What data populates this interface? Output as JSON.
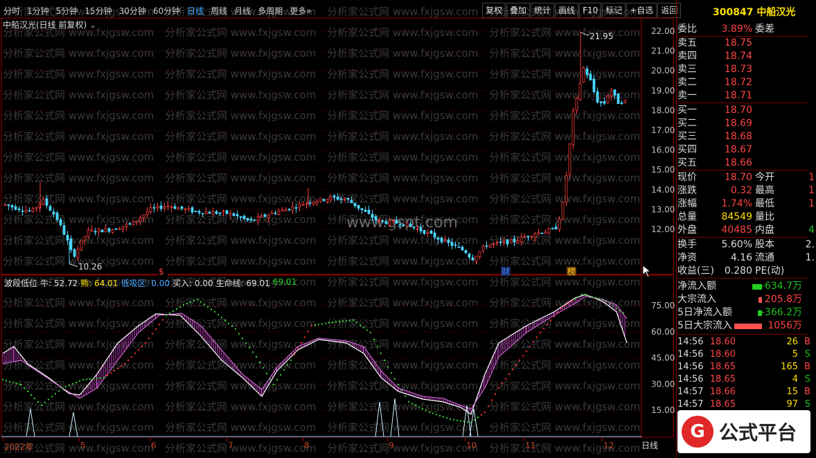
{
  "toolbar": {
    "periods": [
      "分时",
      "1分钟",
      "5分钟",
      "15分钟",
      "30分钟",
      "60分钟",
      "日线",
      "周线",
      "月线",
      "多周期",
      "更多»"
    ],
    "active": "日线",
    "buttons": [
      "复权",
      "叠加",
      "统计",
      "画线",
      "F10",
      "标记",
      "+自选",
      "返回"
    ]
  },
  "chart": {
    "title": "中船汉光(日线 前复权)",
    "price_ticks": [
      "22.00",
      "21.00",
      "20.00",
      "19.00",
      "18.00",
      "17.00",
      "16.00",
      "15.00",
      "14.00",
      "13.00",
      "12.00"
    ],
    "high_label": "21.95",
    "low_label": "10.26",
    "markers": [
      "$",
      "财",
      "榜"
    ],
    "watermark_center": "www.gspt.com",
    "watermark": "分析家公式网 www.fxjgsw.com"
  },
  "indicator": {
    "name": "波段低位",
    "items": [
      {
        "k": "牛:",
        "v": "52.72"
      },
      {
        "k": "熊:",
        "v": "64.01"
      },
      {
        "k": "低吸区:",
        "v": "0.00"
      },
      {
        "k": "买入:",
        "v": "0.00"
      },
      {
        "k": "生命线:",
        "v": "69.01"
      },
      {
        "k": "",
        "v": "69.01"
      }
    ],
    "ticks": [
      "75.00",
      "60.00",
      "45.00",
      "30.00",
      "15.00"
    ]
  },
  "xaxis": {
    "labels": [
      "2022年",
      "5",
      "6",
      "7",
      "8",
      "9",
      "10",
      "11",
      "12"
    ],
    "period": "日线"
  },
  "quote": {
    "code": "300847",
    "name": "中船汉光",
    "wei_bi_label": "委比",
    "wei_bi": "3.89%",
    "wei_cha_label": "委差",
    "asks": [
      {
        "l": "卖五",
        "v": "18.75"
      },
      {
        "l": "卖四",
        "v": "18.74"
      },
      {
        "l": "卖三",
        "v": "18.73"
      },
      {
        "l": "卖二",
        "v": "18.72"
      },
      {
        "l": "卖一",
        "v": "18.71"
      }
    ],
    "bids": [
      {
        "l": "买一",
        "v": "18.70"
      },
      {
        "l": "买二",
        "v": "18.69"
      },
      {
        "l": "买三",
        "v": "18.68"
      },
      {
        "l": "买四",
        "v": "18.67"
      },
      {
        "l": "买五",
        "v": "18.66"
      }
    ],
    "stats": [
      {
        "l": "现价",
        "v": "18.70",
        "c": "red",
        "l2": "今开",
        "v2": "1"
      },
      {
        "l": "涨跌",
        "v": "0.32",
        "c": "red",
        "l2": "最高",
        "v2": "1"
      },
      {
        "l": "涨幅",
        "v": "1.74%",
        "c": "red",
        "l2": "最低",
        "v2": "1"
      },
      {
        "l": "总量",
        "v": "84549",
        "c": "yel",
        "l2": "量比",
        "v2": ""
      },
      {
        "l": "外盘",
        "v": "40485",
        "c": "red",
        "l2": "内盘",
        "v2": "4"
      }
    ],
    "fin": [
      {
        "l": "换手",
        "v": "5.60%",
        "l2": "股本",
        "v2": "2."
      },
      {
        "l": "净资",
        "v": "4.16",
        "l2": "流通",
        "v2": "1."
      },
      {
        "l": "收益(三)",
        "v": "0.280",
        "l2": "PE(动)",
        "v2": ""
      }
    ],
    "flows": [
      {
        "l": "净流入额",
        "v": "-634.7万",
        "c": "grn",
        "bar": 14
      },
      {
        "l": "大宗流入",
        "v": "205.8万",
        "c": "red",
        "bar": 5
      },
      {
        "l": "5日净流入额",
        "v": "-366.2万",
        "c": "grn",
        "bar": 6
      },
      {
        "l": "5日大宗流入",
        "v": "1056万",
        "c": "red",
        "bar": 40
      }
    ],
    "ticks": [
      {
        "t": "14:56",
        "p": "18.60",
        "q": "26",
        "s": "B"
      },
      {
        "t": "14:56",
        "p": "18.60",
        "q": "5",
        "s": "S"
      },
      {
        "t": "14:56",
        "p": "18.65",
        "q": "165",
        "s": "B"
      },
      {
        "t": "14:56",
        "p": "18.65",
        "q": "4",
        "s": "S"
      },
      {
        "t": "14:57",
        "p": "18.66",
        "q": "15",
        "s": "B"
      },
      {
        "t": "14:57",
        "p": "18.65",
        "q": "97",
        "s": "S"
      }
    ]
  },
  "logo": {
    "text": "公式平台",
    "mark": "G"
  }
}
